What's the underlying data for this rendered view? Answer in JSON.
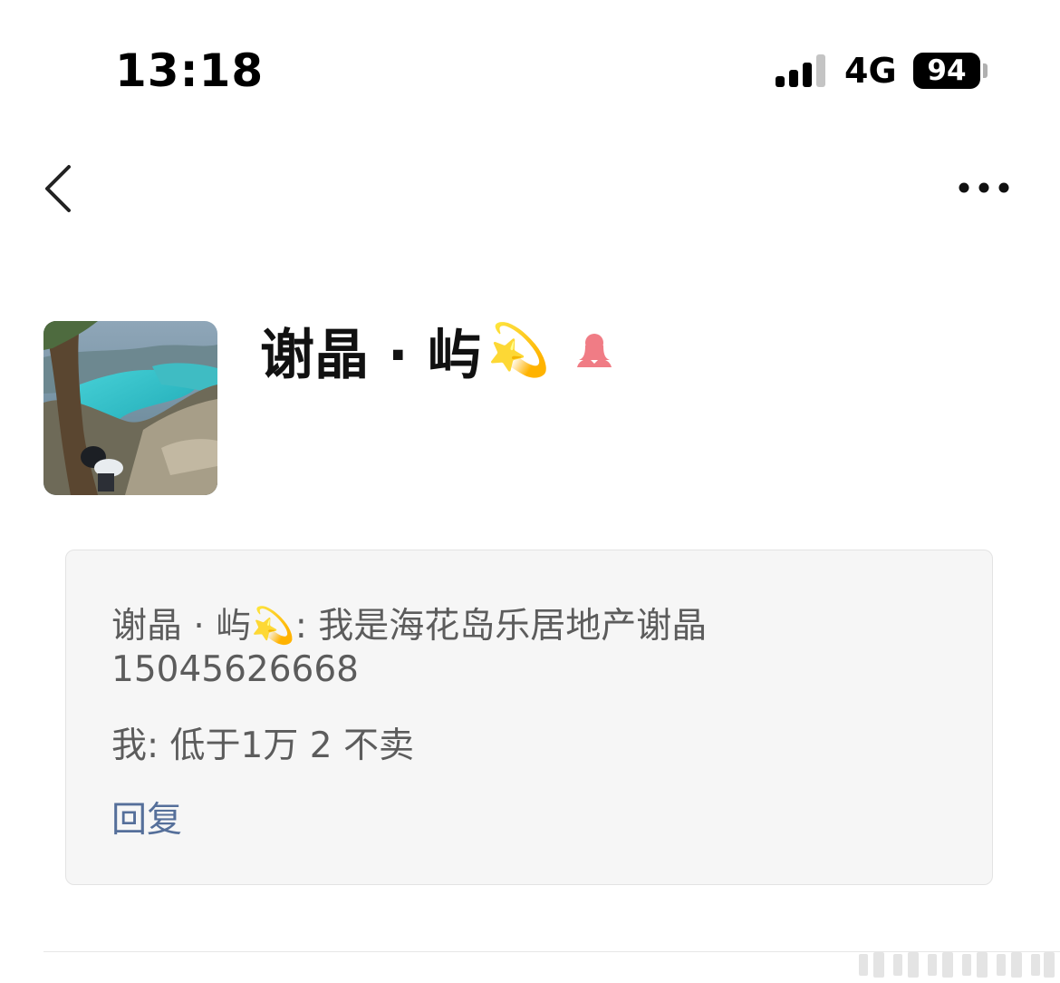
{
  "status_bar": {
    "time": "13:18",
    "network": "4G",
    "battery": "94"
  },
  "nav": {
    "back_icon": "chevron-left-icon",
    "more_icon": "more-horizontal-icon"
  },
  "profile": {
    "name": "谢晶 · 屿",
    "name_emoji": "💫",
    "gender_icon": "female-icon",
    "gender_color": "#f07c85"
  },
  "message_card": {
    "sender_name": "谢晶 · 屿",
    "sender_emoji": "💫",
    "line1_text": ": 我是海花岛乐居地产谢晶 15045626668",
    "line2_text": "我: 低于1万 2 不卖",
    "reply_label": "回复",
    "reply_color": "#556f9a",
    "text_color": "#5c5c5c"
  }
}
